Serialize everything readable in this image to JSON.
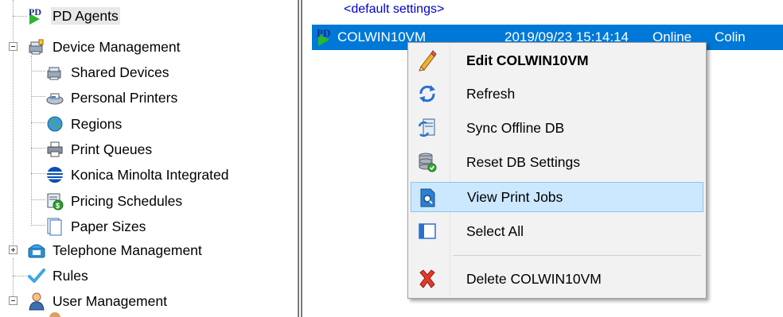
{
  "tree": {
    "items": [
      {
        "label": "PD Agents",
        "icon": "pd-agents-icon"
      },
      {
        "label": "Device Management",
        "icon": "device-management-icon"
      },
      {
        "label": "Shared Devices",
        "icon": "shared-devices-icon"
      },
      {
        "label": "Personal Printers",
        "icon": "personal-printers-icon"
      },
      {
        "label": "Regions",
        "icon": "regions-icon"
      },
      {
        "label": "Print Queues",
        "icon": "print-queues-icon"
      },
      {
        "label": "Konica Minolta Integrated",
        "icon": "konica-minolta-icon"
      },
      {
        "label": "Pricing Schedules",
        "icon": "pricing-schedules-icon"
      },
      {
        "label": "Paper Sizes",
        "icon": "paper-sizes-icon"
      },
      {
        "label": "Telephone Management",
        "icon": "telephone-management-icon"
      },
      {
        "label": "Rules",
        "icon": "rules-icon"
      },
      {
        "label": "User Management",
        "icon": "user-management-icon"
      }
    ]
  },
  "list": {
    "default_settings": "<default settings>",
    "selected_row": {
      "name": "COLWIN10VM",
      "date": "2019/09/23 15:14:14",
      "status": "Online",
      "user": "Colin",
      "icon": "pd-agent-icon"
    }
  },
  "context_menu": {
    "items": [
      {
        "label": "Edit COLWIN10VM",
        "icon": "pencil-icon",
        "bold": true
      },
      {
        "label": "Refresh",
        "icon": "refresh-icon"
      },
      {
        "label": "Sync Offline DB",
        "icon": "sync-icon"
      },
      {
        "label": "Reset DB Settings",
        "icon": "database-reset-icon"
      },
      {
        "label": "View Print Jobs",
        "icon": "view-print-jobs-icon",
        "highlighted": true
      },
      {
        "label": "Select All",
        "icon": "select-all-icon"
      },
      {
        "label": "Delete COLWIN10VM",
        "icon": "delete-icon"
      }
    ]
  },
  "colors": {
    "selection": "#0078d7",
    "menu_highlight": "#cce8ff",
    "link_blue": "#0000cc"
  }
}
